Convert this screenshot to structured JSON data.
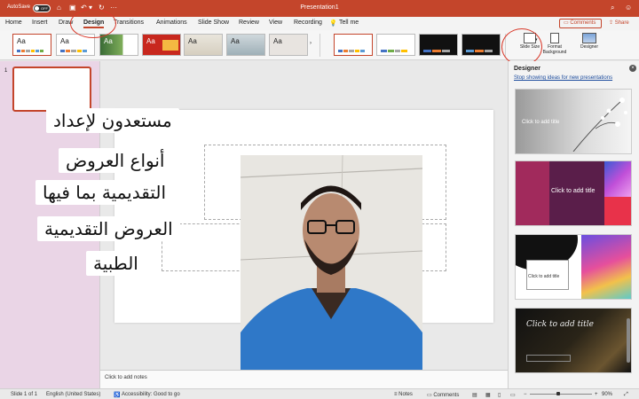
{
  "titlebar": {
    "autosave_label": "AutoSave",
    "autosave_state": "OFF",
    "document_title": "Presentation1"
  },
  "menu": {
    "tabs": [
      "Home",
      "Insert",
      "Draw",
      "Design",
      "Transitions",
      "Animations",
      "Slide Show",
      "Review",
      "View",
      "Recording"
    ],
    "active_tab": "Design",
    "tell_me": "Tell me",
    "comments_label": "Comments",
    "share_label": "Share"
  },
  "ribbon": {
    "theme_sample": "Aa",
    "slide_size_label": "Slide Size",
    "format_background_label": "Format Background",
    "designer_label": "Designer"
  },
  "thumbnails": {
    "slide_number": "1"
  },
  "slide": {
    "arabic_lines": [
      "مستعدون لإعداد",
      "أنواع العروض",
      "التقديمية بما فيها",
      "العروض التقديمية",
      "الطبية"
    ]
  },
  "notes": {
    "placeholder": "Click to add notes"
  },
  "designer": {
    "title": "Designer",
    "stop_link": "Stop showing ideas for new presentations",
    "card_title_placeholder": "Click to add title"
  },
  "status": {
    "slide_info": "Slide 1 of 1",
    "language": "English (United States)",
    "accessibility": "Accessibility: Good to go",
    "notes_label": "Notes",
    "comments_label": "Comments",
    "zoom": "90%"
  },
  "colors": {
    "accent": "#c4452b",
    "thumb_panel": "#ead5e6",
    "annotation": "#d93a2b"
  }
}
